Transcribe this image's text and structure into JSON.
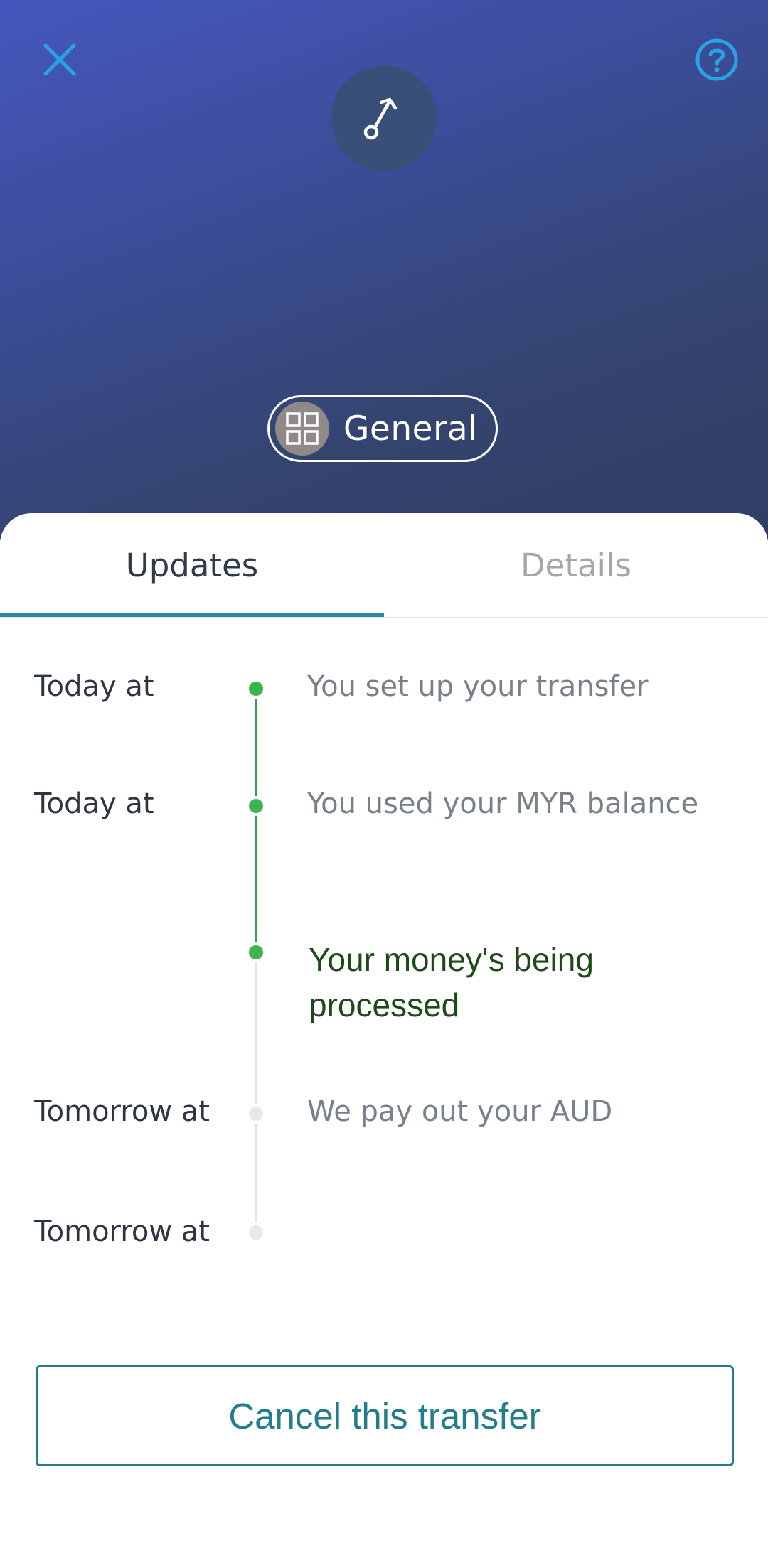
{
  "header": {
    "close_icon": "close-icon",
    "help_icon": "help-icon",
    "transfer_icon": "transfer-arrow-icon",
    "category": {
      "icon": "grid-icon",
      "label": "General"
    },
    "colors": {
      "gradient_start": "#4557bd",
      "gradient_end": "#2f3e64",
      "accent": "#2aa3e6"
    }
  },
  "tabs": [
    {
      "label": "Updates",
      "active": true
    },
    {
      "label": "Details",
      "active": false
    }
  ],
  "timeline": {
    "items": [
      {
        "time": "Today at",
        "event": "You set up your transfer",
        "status": "done"
      },
      {
        "time": "Today at",
        "event": "You used your MYR balance",
        "status": "done"
      },
      {
        "time": "",
        "event": "Your money's being processed",
        "status": "current"
      },
      {
        "time": "Tomorrow at",
        "event": "We pay out your AUD",
        "status": "pending"
      },
      {
        "time": "Tomorrow at",
        "event": "",
        "status": "pending"
      }
    ],
    "colors": {
      "done": "#3db44f",
      "pending": "#e1e4e8",
      "current_text": "#1d4a18"
    }
  },
  "actions": {
    "cancel_label": "Cancel this transfer",
    "accent": "#227e8c"
  }
}
